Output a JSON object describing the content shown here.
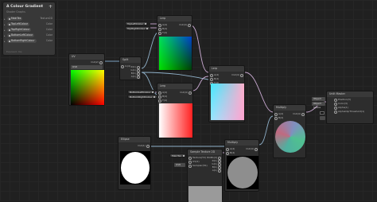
{
  "blackboard": {
    "title": "A Colour Gradient",
    "subtitle": "Shader Graphs",
    "add_icon": "+",
    "properties": [
      {
        "name": "MainTex",
        "type": "Texture2D"
      },
      {
        "name": "TopLeftColour",
        "type": "Color"
      },
      {
        "name": "TopRightColour",
        "type": "Color"
      },
      {
        "name": "BottomLeftColour",
        "type": "Color"
      },
      {
        "name": "BottomRightColour",
        "type": "Color"
      }
    ],
    "footer": "Exposed: Yes"
  },
  "nodes": {
    "uv": {
      "title": "UV",
      "channel": "UV0",
      "out": "Out(2)"
    },
    "split": {
      "title": "Split",
      "in": "In(4)",
      "outs": [
        "R(1)",
        "G(1)",
        "B(1)",
        "A(1)"
      ]
    },
    "lerp_top": {
      "title": "Lerp",
      "ins": [
        "A(4)",
        "B(4)",
        "T(4)"
      ],
      "out": "Out(4)"
    },
    "lerp_bottom": {
      "title": "Lerp",
      "ins": [
        "A(4)",
        "B(4)",
        "T(4)"
      ],
      "out": "Out(4)"
    },
    "lerp_final": {
      "title": "Lerp",
      "ins": [
        "A(4)",
        "B(4)",
        "T(4)"
      ],
      "out": "Out(4)"
    },
    "multiply_final": {
      "title": "Multiply",
      "ins": [
        "A(4)",
        "B(4)"
      ],
      "out": "Out(4)"
    },
    "multiply_mid": {
      "title": "Multiply",
      "ins": [
        "A(4)",
        "B(4)"
      ],
      "out": "Out(4)"
    },
    "sample_tex": {
      "title": "Sample Texture 2D",
      "outs": [
        "RGBA(4)",
        "R(1)",
        "G(1)",
        "B(1)",
        "A(1)"
      ],
      "ins": [
        "Texture(T2)",
        "UV(2)",
        "Sampler(SS)"
      ],
      "uv_value": "UV0"
    },
    "ellipse": {
      "title": "Ellipse",
      "out": "Out(1)"
    },
    "master": {
      "title": "Unlit Master",
      "ins": [
        "Position(3)",
        "Color(3)",
        "Alpha(1)",
        "AlphaClipThreshold(1)"
      ],
      "fields": [
        "Object Space",
        "Object Space"
      ]
    }
  },
  "prop_chips": {
    "top_left": "TopLeftColour",
    "top_right": "TopRightColour",
    "bottom_left": "BottomLeftColour",
    "bottom_right": "BottomRightColour",
    "main_tex": "MainTex"
  }
}
